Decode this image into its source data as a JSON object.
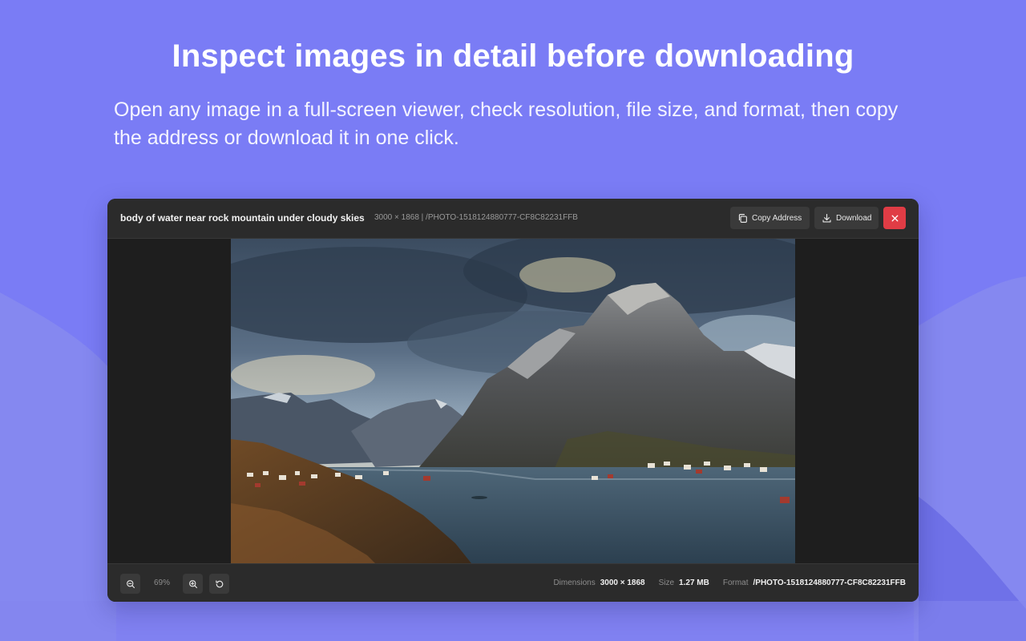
{
  "hero": {
    "title": "Inspect images in detail before downloading",
    "description": "Open any image in a full-screen viewer, check resolution, file size, and format, then copy the address or download it in one click."
  },
  "viewer": {
    "image_title": "body of water near rock mountain under cloudy skies",
    "image_meta": "3000 × 1868 | /PHOTO-1518124880777-CF8C82231FFB",
    "copy_label": "Copy Address",
    "download_label": "Download",
    "zoom_level": "69%",
    "stats": {
      "dimensions_label": "Dimensions",
      "dimensions_value": "3000 × 1868",
      "size_label": "Size",
      "size_value": "1.27 MB",
      "format_label": "Format",
      "format_value": "/PHOTO-1518124880777-CF8C82231FFB"
    }
  },
  "icons": {
    "copy": "copy-icon",
    "download": "download-icon",
    "close": "close-icon",
    "zoom_out": "zoom-out-icon",
    "zoom_in": "zoom-in-icon",
    "reset": "reset-rotate-icon"
  },
  "colors": {
    "background": "#7a7cf5",
    "viewer_bar": "#2b2b2b",
    "button": "#3a3a3a",
    "close_button": "#e03c45"
  }
}
